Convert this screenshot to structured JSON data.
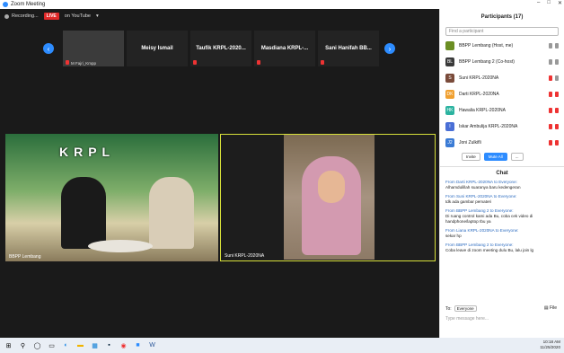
{
  "window": {
    "title": "Zoom Meeting"
  },
  "recording": {
    "label": "Recording..."
  },
  "live": {
    "badge": "LIVE",
    "target": "on YouTube"
  },
  "strip": {
    "tiles": [
      {
        "name": "",
        "caption": "M Fajri_Kmpp"
      },
      {
        "name": "Meisy Ismail",
        "caption": ""
      },
      {
        "name": "Taufik KRPL-2020...",
        "caption": ""
      },
      {
        "name": "Masdiana KRPL-...",
        "caption": ""
      },
      {
        "name": "Sani Hanifah BB...",
        "caption": ""
      }
    ]
  },
  "video1": {
    "title": "KRPL",
    "subtitle": "...",
    "label": "BBPP Lembang"
  },
  "video2": {
    "label": "Suni KRPL-2020NA"
  },
  "participants": {
    "header": "Participants (17)",
    "search_placeholder": "Find a participant",
    "items": [
      {
        "initials": "",
        "name": "BBPP Lembang (Host, me)",
        "color": "#6b8e23"
      },
      {
        "initials": "BL",
        "name": "BBPP Lembang 2 (Co-host)",
        "color": "#3a3a3a"
      },
      {
        "initials": "S",
        "name": "Suni KRPL-2020NA",
        "color": "#7a4b3a"
      },
      {
        "initials": "DK",
        "name": "Darti KRPL-2020NA",
        "color": "#f0a030"
      },
      {
        "initials": "HK",
        "name": "Hawalia KRPL-2020NA",
        "color": "#2bb3a0"
      },
      {
        "initials": "I",
        "name": "Iskar Ambulija KRPL-2020NA",
        "color": "#4a6fd6"
      },
      {
        "initials": "J2",
        "name": "Joni Zulkifli",
        "color": "#3a7bd5"
      }
    ],
    "invite": "Invite",
    "mute_all": "Mute All",
    "more": "..."
  },
  "chat": {
    "header": "Chat",
    "messages": [
      {
        "from": "From Darti KRPL-2020NA to Everyone:",
        "text": "Alhamdulillah suaranya baru kedengeran"
      },
      {
        "from": "From Suni KRPL-2020NA to Everyone:",
        "text": "tdk ada gambar pemateri"
      },
      {
        "from": "From BBPP Lembang 2 to Everyone:",
        "text": "Di ruang control kami ada Bu, coba cek video di handphone/laptop Ibu ya"
      },
      {
        "from": "From Liana KRPL-2020NA to Everyone:",
        "text": "sekar hp"
      },
      {
        "from": "From BBPP Lembang 2 to Everyone:",
        "text": "Coba leave di zoom meeting dulu Bu, lalu join lg"
      }
    ],
    "to_label": "To:",
    "to_value": "Everyone",
    "file": "File",
    "input_placeholder": "Type message here..."
  },
  "taskbar": {
    "time": "10:18 AM",
    "date": "11/25/2020"
  }
}
